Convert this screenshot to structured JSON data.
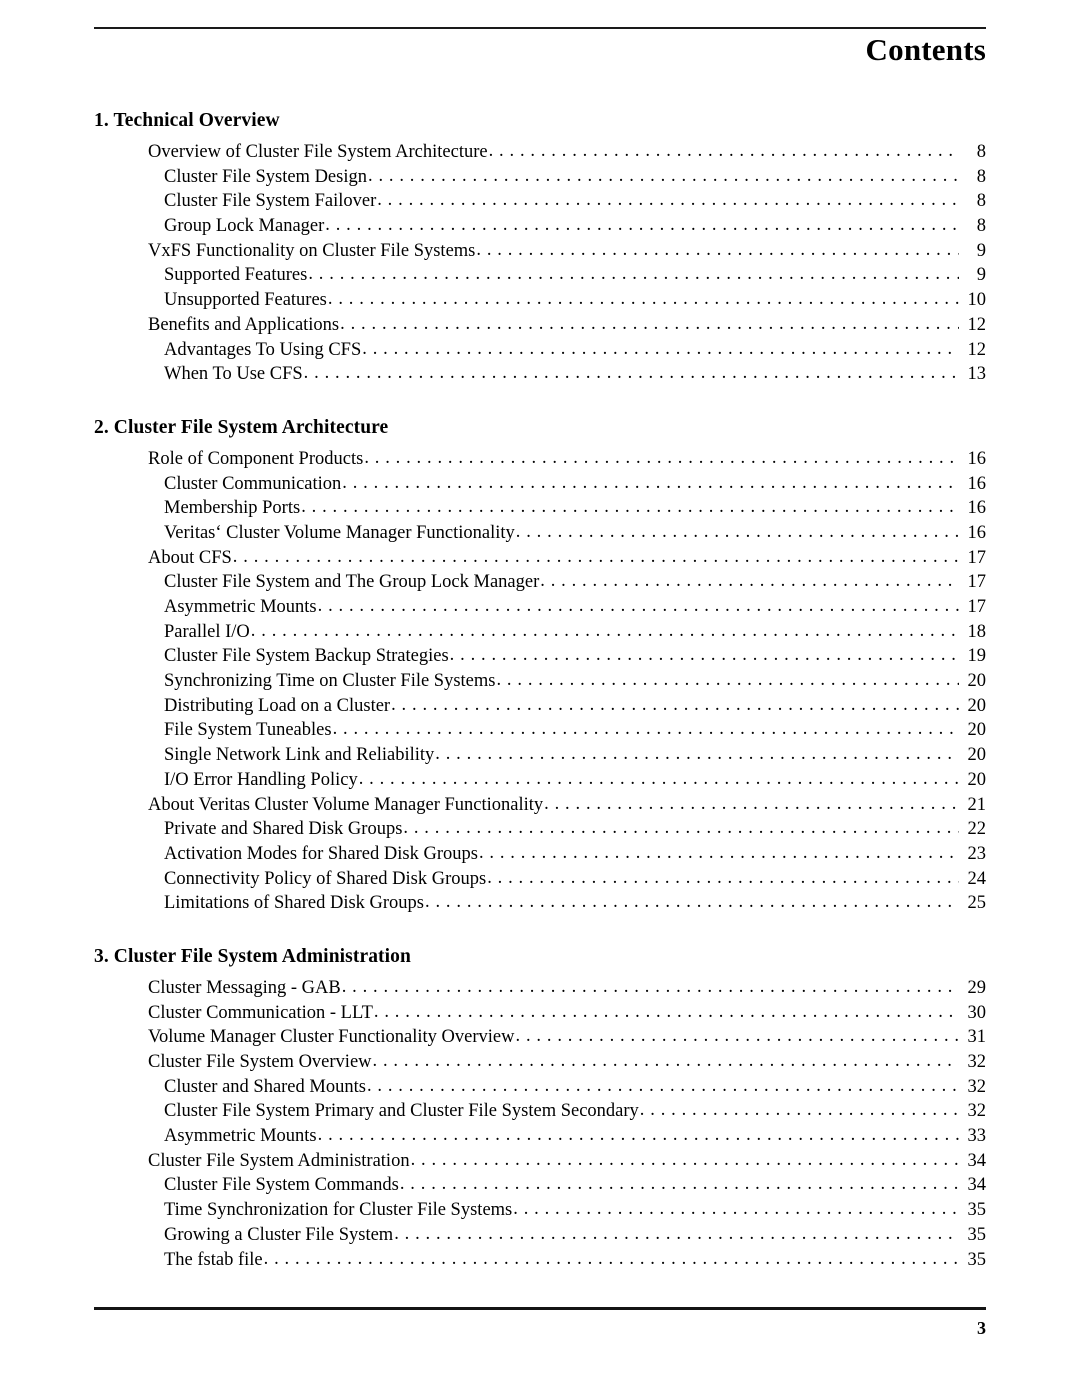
{
  "header": {
    "title": "Contents"
  },
  "footer": {
    "page_number": "3"
  },
  "sections": [
    {
      "title": "1. Technical Overview",
      "entries": [
        {
          "label": "Overview of Cluster File System Architecture",
          "page": "8",
          "level": 1
        },
        {
          "label": "Cluster File System Design",
          "page": "8",
          "level": 2
        },
        {
          "label": "Cluster File System Failover",
          "page": "8",
          "level": 2
        },
        {
          "label": "Group Lock Manager",
          "page": "8",
          "level": 2
        },
        {
          "label": "VxFS Functionality on Cluster File Systems",
          "page": "9",
          "level": 1
        },
        {
          "label": "Supported Features",
          "page": "9",
          "level": 2
        },
        {
          "label": "Unsupported Features",
          "page": "10",
          "level": 2
        },
        {
          "label": "Benefits and Applications",
          "page": "12",
          "level": 1
        },
        {
          "label": "Advantages To Using CFS",
          "page": "12",
          "level": 2
        },
        {
          "label": "When To Use CFS",
          "page": "13",
          "level": 2
        }
      ]
    },
    {
      "title": "2. Cluster File System Architecture",
      "entries": [
        {
          "label": "Role of Component Products",
          "page": "16",
          "level": 1
        },
        {
          "label": "Cluster Communication",
          "page": "16",
          "level": 2
        },
        {
          "label": "Membership Ports",
          "page": "16",
          "level": 2
        },
        {
          "label": "Veritas‘ Cluster Volume Manager Functionality",
          "page": "16",
          "level": 2
        },
        {
          "label": "About CFS",
          "page": "17",
          "level": 1
        },
        {
          "label": "Cluster File System and The Group Lock Manager",
          "page": "17",
          "level": 2
        },
        {
          "label": "Asymmetric Mounts",
          "page": "17",
          "level": 2
        },
        {
          "label": "Parallel I/O",
          "page": "18",
          "level": 2
        },
        {
          "label": "Cluster File System Backup Strategies",
          "page": "19",
          "level": 2
        },
        {
          "label": "Synchronizing Time on Cluster File Systems",
          "page": "20",
          "level": 2
        },
        {
          "label": "Distributing Load on a Cluster",
          "page": "20",
          "level": 2
        },
        {
          "label": "File System Tuneables",
          "page": "20",
          "level": 2
        },
        {
          "label": "Single Network Link and Reliability",
          "page": "20",
          "level": 2
        },
        {
          "label": "I/O Error Handling Policy",
          "page": "20",
          "level": 2
        },
        {
          "label": "About Veritas Cluster Volume Manager Functionality",
          "page": "21",
          "level": 1
        },
        {
          "label": "Private and Shared Disk Groups",
          "page": "22",
          "level": 2
        },
        {
          "label": "Activation Modes for Shared Disk Groups",
          "page": "23",
          "level": 2
        },
        {
          "label": "Connectivity Policy of Shared Disk Groups",
          "page": "24",
          "level": 2
        },
        {
          "label": "Limitations of Shared Disk Groups",
          "page": "25",
          "level": 2
        }
      ]
    },
    {
      "title": "3. Cluster File System Administration",
      "entries": [
        {
          "label": "Cluster Messaging - GAB",
          "page": "29",
          "level": 1
        },
        {
          "label": "Cluster Communication - LLT",
          "page": "30",
          "level": 1
        },
        {
          "label": "Volume Manager Cluster Functionality Overview",
          "page": "31",
          "level": 1
        },
        {
          "label": "Cluster File System Overview",
          "page": "32",
          "level": 1
        },
        {
          "label": "Cluster and Shared Mounts",
          "page": "32",
          "level": 2
        },
        {
          "label": "Cluster File System Primary and Cluster File System Secondary",
          "page": "32",
          "level": 2
        },
        {
          "label": "Asymmetric Mounts",
          "page": "33",
          "level": 2
        },
        {
          "label": "Cluster File System Administration",
          "page": "34",
          "level": 1
        },
        {
          "label": "Cluster File System Commands",
          "page": "34",
          "level": 2
        },
        {
          "label": "Time Synchronization for Cluster File Systems",
          "page": "35",
          "level": 2
        },
        {
          "label": "Growing a Cluster File System",
          "page": "35",
          "level": 2
        },
        {
          "label": "The fstab file",
          "page": "35",
          "level": 2
        }
      ]
    }
  ]
}
